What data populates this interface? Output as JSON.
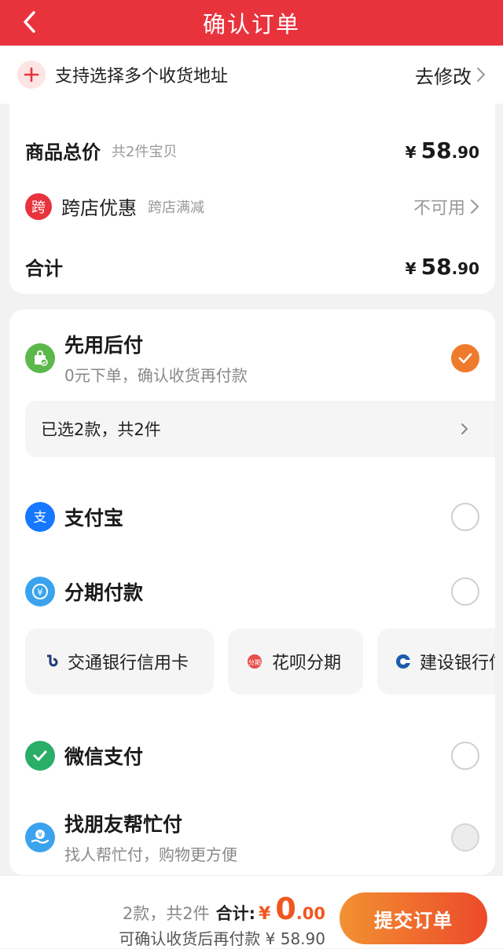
{
  "header": {
    "title": "确认订单",
    "back_icon": "chevron-left-icon"
  },
  "address_bar": {
    "text": "支持选择多个收货地址",
    "action_label": "去修改"
  },
  "summary": {
    "goods_total_label": "商品总价",
    "goods_total_sub": "共2件宝贝",
    "goods_total_currency": "¥",
    "goods_total_int": "58",
    "goods_total_dec": ".90",
    "discount_badge": "跨",
    "discount_label": "跨店优惠",
    "discount_sub": "跨店满减",
    "discount_status": "不可用",
    "total_label": "合计",
    "total_currency": "¥",
    "total_int": "58",
    "total_dec": ".90"
  },
  "payment": {
    "pay_later": {
      "title": "先用后付",
      "desc": "0元下单，确认收货再付款",
      "selected": true,
      "selected_items": "已选2款，共2件"
    },
    "alipay": {
      "title": "支付宝"
    },
    "installment": {
      "title": "分期付款",
      "options": [
        {
          "label": "交通银行信用卡",
          "icon": "bocom-icon"
        },
        {
          "label": "花呗分期",
          "icon": "huabei-icon"
        },
        {
          "label": "建设银行信用卡",
          "icon": "ccb-icon"
        }
      ]
    },
    "wechat": {
      "title": "微信支付"
    },
    "friend_pay": {
      "title": "找朋友帮忙付",
      "desc": "找人帮忙付，购物更方便"
    }
  },
  "bottom_bar": {
    "count_text": "2款，共2件",
    "total_label": "合计:",
    "currency": "¥",
    "amount_int": "0",
    "amount_dec": ".00",
    "note": "可确认收货后再付款 ¥ 58.90",
    "submit_label": "提交订单"
  },
  "colors": {
    "brand_red": "#e8333d",
    "accent_orange": "#f07a2c",
    "price_orange": "#f1561f"
  }
}
